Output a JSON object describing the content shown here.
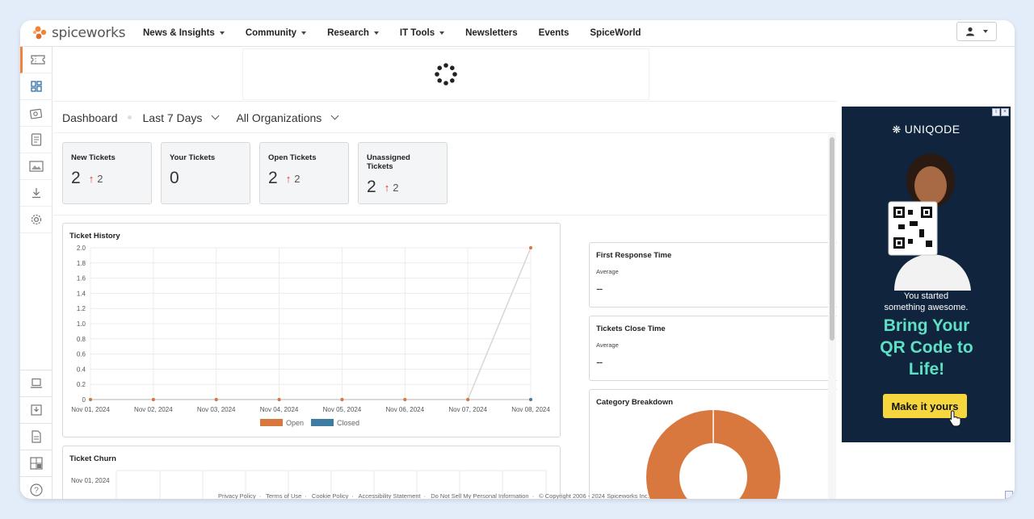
{
  "brand": {
    "name": "spiceworks",
    "color": "#f0853a"
  },
  "nav": {
    "items": [
      {
        "label": "News & Insights",
        "dropdown": true
      },
      {
        "label": "Community",
        "dropdown": true
      },
      {
        "label": "Research",
        "dropdown": true
      },
      {
        "label": "IT Tools",
        "dropdown": true
      },
      {
        "label": "Newsletters",
        "dropdown": false
      },
      {
        "label": "Events",
        "dropdown": false
      },
      {
        "label": "SpiceWorld",
        "dropdown": false
      }
    ]
  },
  "sidebar": {
    "top_icons": [
      "ticket-icon",
      "dashboard-icon",
      "inventory-icon",
      "reports-icon",
      "images-icon",
      "download-icon",
      "settings-icon"
    ],
    "bottom_icons": [
      "laptop-icon",
      "download-tray-icon",
      "document-icon",
      "widgets-icon",
      "help-icon"
    ]
  },
  "dashboard": {
    "title": "Dashboard",
    "period": "Last 7 Days",
    "organization": "All Organizations"
  },
  "stats": [
    {
      "label": "New Tickets",
      "value": "2",
      "delta": "2",
      "has_delta": true
    },
    {
      "label": "Your Tickets",
      "value": "0",
      "delta": "",
      "has_delta": false
    },
    {
      "label": "Open Tickets",
      "value": "2",
      "delta": "2",
      "has_delta": true
    },
    {
      "label": "Unassigned Tickets",
      "value": "2",
      "delta": "2",
      "has_delta": true
    }
  ],
  "panels": {
    "ticket_history": {
      "title": "Ticket History"
    },
    "first_response": {
      "title": "First Response Time",
      "sub": "Average",
      "value": "--"
    },
    "close_time": {
      "title": "Tickets Close Time",
      "sub": "Average",
      "value": "--"
    },
    "category": {
      "title": "Category Breakdown"
    },
    "ticket_churn": {
      "title": "Ticket Churn",
      "first_row": "Nov 01, 2024"
    }
  },
  "chart_data": [
    {
      "type": "line",
      "title": "Ticket History",
      "categories": [
        "Nov 01, 2024",
        "Nov 02, 2024",
        "Nov 03, 2024",
        "Nov 04, 2024",
        "Nov 05, 2024",
        "Nov 06, 2024",
        "Nov 07, 2024",
        "Nov 08, 2024"
      ],
      "series": [
        {
          "name": "Open",
          "color": "#d9783e",
          "values": [
            0,
            0,
            0,
            0,
            0,
            0,
            0,
            2
          ]
        },
        {
          "name": "Closed",
          "color": "#3f7ca3",
          "values": [
            0,
            0,
            0,
            0,
            0,
            0,
            0,
            0
          ]
        }
      ],
      "yticks": [
        "0",
        "0.2",
        "0.4",
        "0.6",
        "0.8",
        "1.0",
        "1.2",
        "1.4",
        "1.6",
        "1.8",
        "2.0"
      ],
      "ylim": [
        0,
        2
      ],
      "grid": true,
      "legend": "bottom"
    },
    {
      "type": "pie",
      "title": "Category Breakdown",
      "slices": [
        {
          "value": 100,
          "color": "#d9783e"
        }
      ]
    }
  ],
  "ad": {
    "brand": "UNIQODE",
    "line1": "You started",
    "line2": "something awesome.",
    "headline1": "Bring Your",
    "headline2": "QR Code to",
    "headline3": "Life!",
    "cta": "Make it yours",
    "bg": "#10243d",
    "accent": "#5ee0c4"
  },
  "footer": {
    "links": [
      "Privacy Policy",
      "Terms of Use",
      "Cookie Policy",
      "Accessibility Statement",
      "Do Not Sell My Personal Information",
      "© Copyright 2006 - 2024 Spiceworks Inc."
    ]
  }
}
